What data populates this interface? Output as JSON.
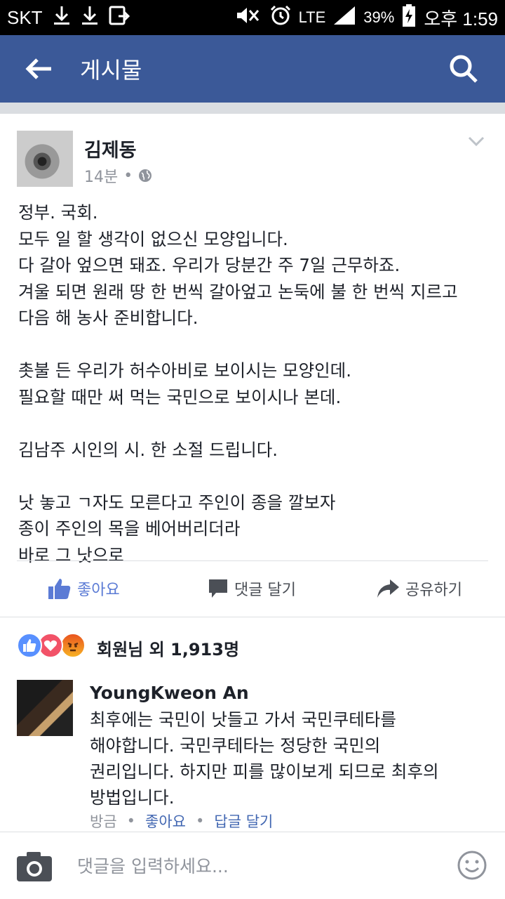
{
  "status_bar": {
    "carrier": "SKT",
    "network": "LTE",
    "battery": "39%",
    "time": "오후 1:59"
  },
  "header": {
    "title": "게시물"
  },
  "post": {
    "author": "김제동",
    "time": "14분",
    "separator": "•",
    "lines": [
      "정부. 국회.",
      "모두 일 할 생각이 없으신 모양입니다.",
      "다 갈아 엎으면 돼죠. 우리가 당분간 주 7일 근무하죠.",
      "겨울 되면 원래 땅 한 번씩 갈아엎고 논둑에 불 한 번씩 지르고",
      "다음 해 농사 준비합니다.",
      "",
      "촛불 든 우리가 허수아비로 보이시는 모양인데.",
      "필요할 때만 써 먹는 국민으로 보이시나 본데.",
      "",
      "김남주 시인의 시. 한 소절 드립니다.",
      "",
      "낫 놓고 ㄱ자도 모른다고 주인이 종을 깔보자",
      "종이 주인의 목을 베어버리더라",
      "바로 그 낫으로"
    ],
    "actions": {
      "like": "좋아요",
      "comment": "댓글 달기",
      "share": "공유하기"
    }
  },
  "reactions": {
    "summary": "회원님 외 1,913명",
    "icons": [
      "like-icon",
      "love-icon",
      "angry-icon"
    ]
  },
  "comment": {
    "author": "YoungKweon An",
    "lines": [
      "최후에는 국민이 낫들고 가서 국민쿠테타를",
      "해야합니다. 국민쿠테타는 정당한 국민의",
      "권리입니다. 하지만 피를 많이보게 되므로 최후의",
      "방법입니다."
    ],
    "time": "방금",
    "sep": "•",
    "like": "좋아요",
    "reply": "답글 달기"
  },
  "input": {
    "placeholder": "댓글을 입력하세요..."
  },
  "colors": {
    "brand": "#3b5998",
    "like_blue": "#5b7bd5",
    "meta_gray": "#90949c"
  }
}
